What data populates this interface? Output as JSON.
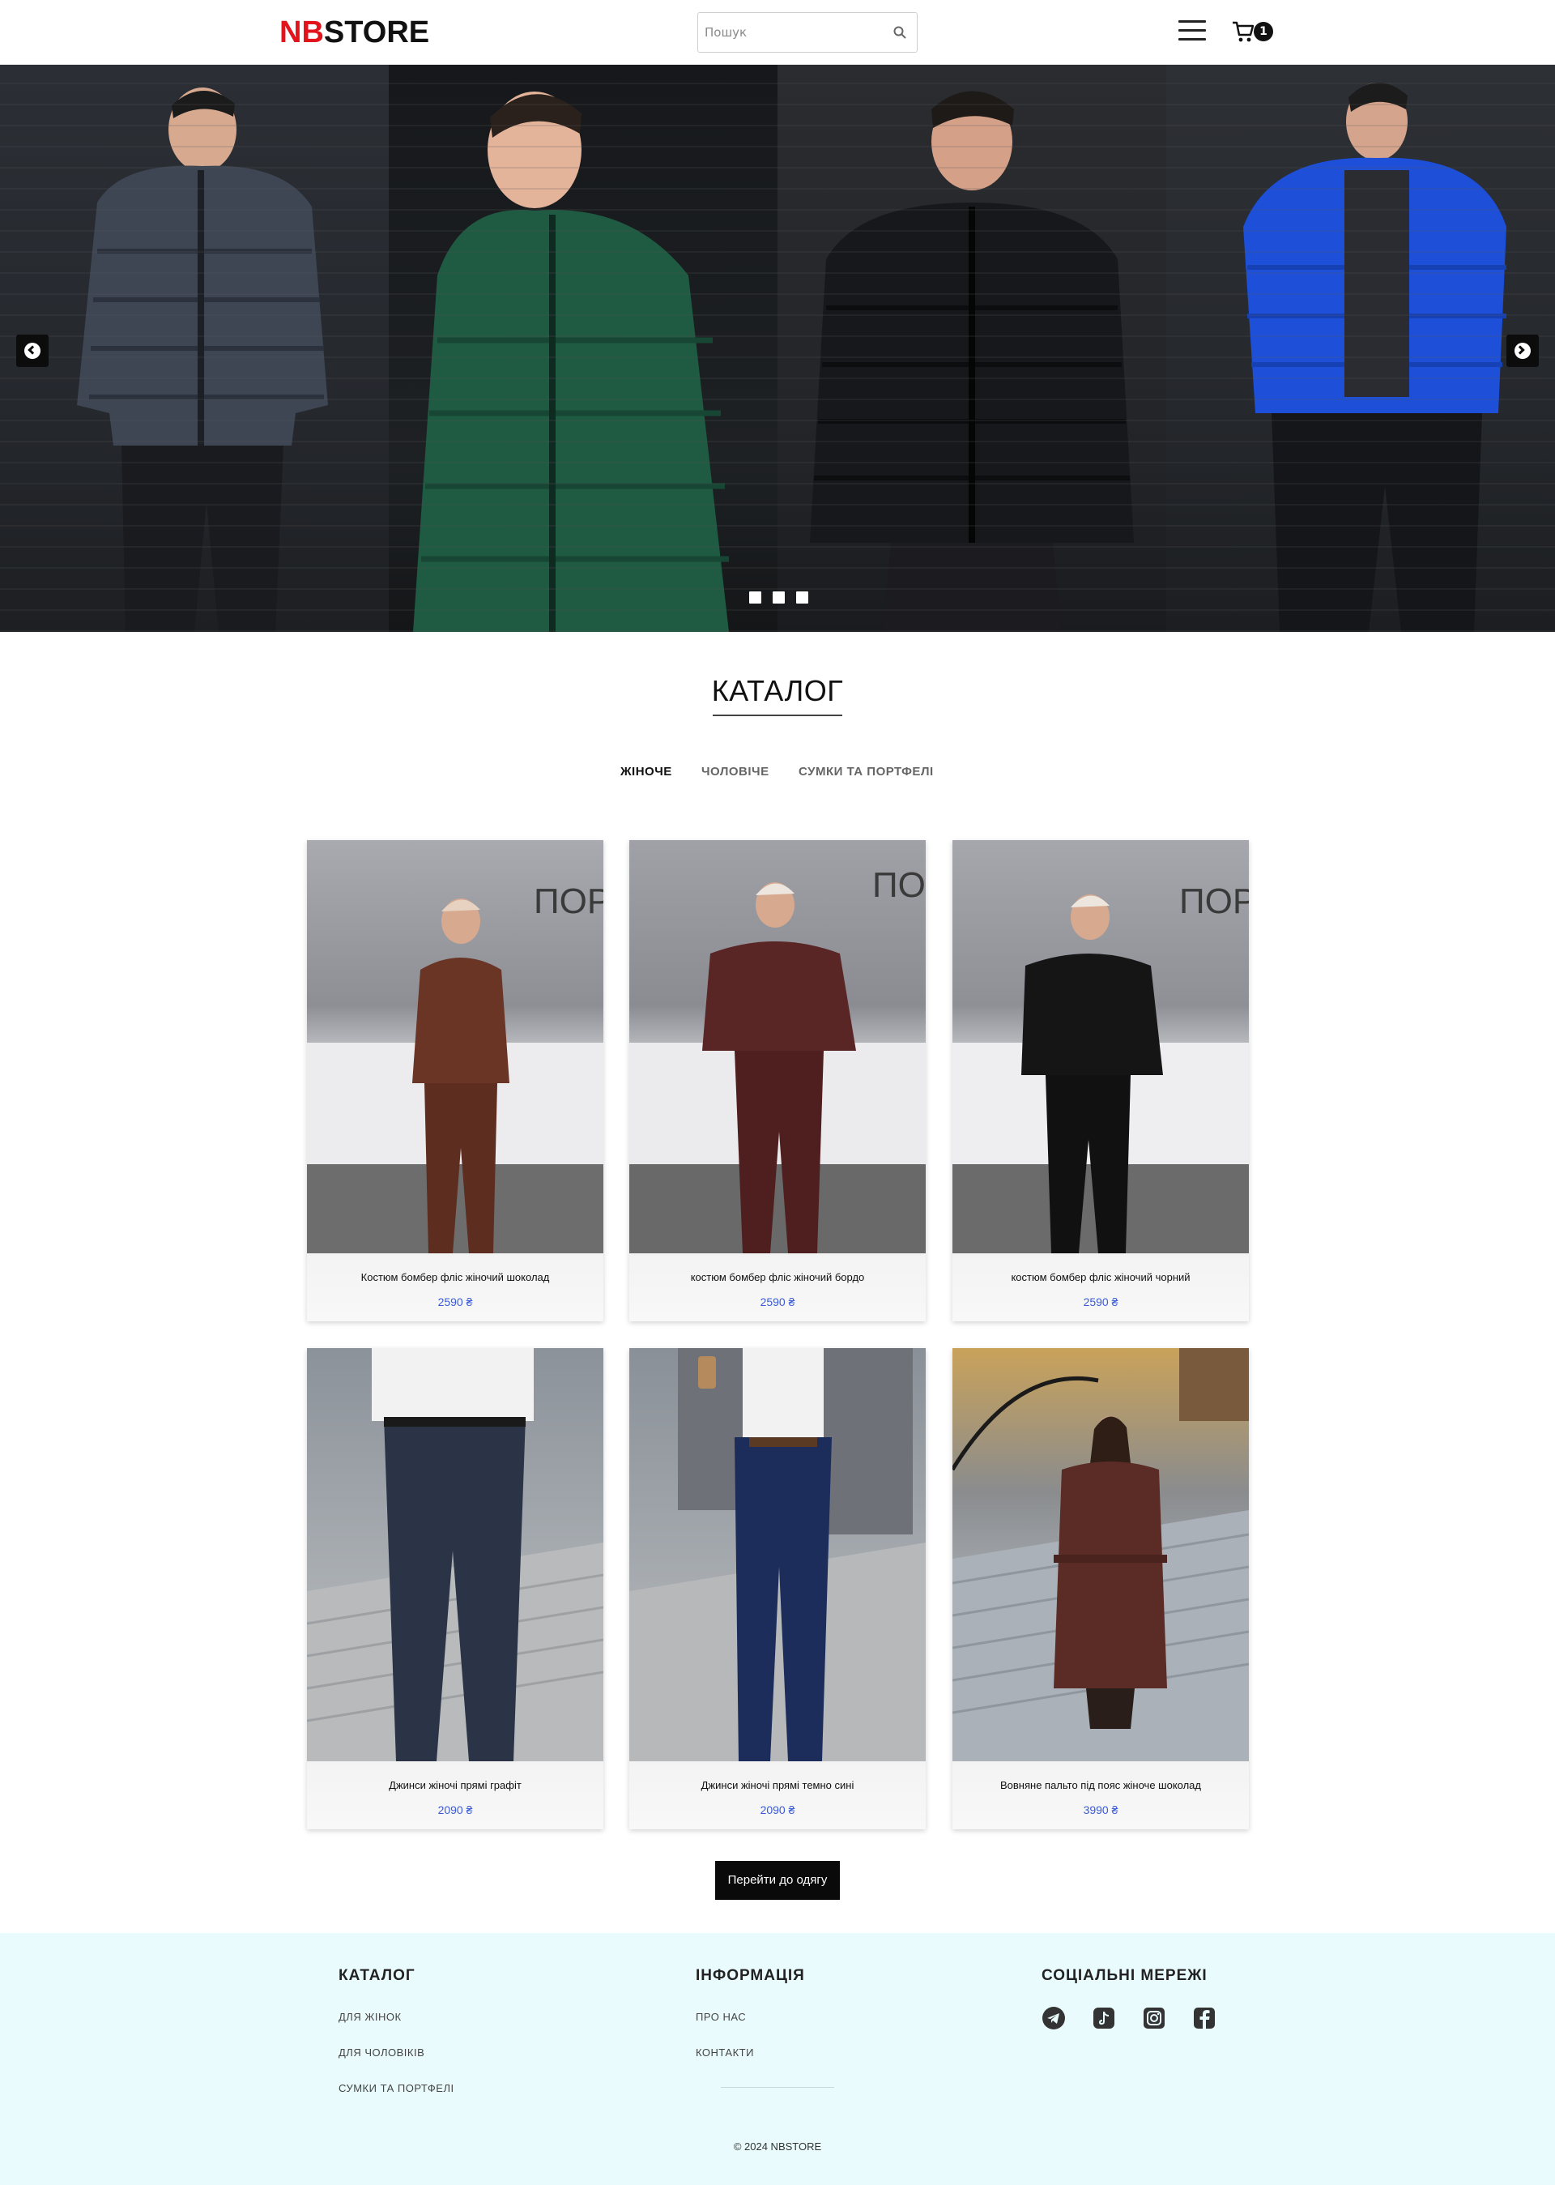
{
  "header": {
    "logo_nb": "NB",
    "logo_store": "STORE",
    "search_placeholder": "Пошук",
    "cart_count": "1"
  },
  "hero": {
    "slides": 3,
    "active_slide": 1,
    "panels": [
      {
        "jacket_color": "#3e4654"
      },
      {
        "jacket_color": "#1f5a42"
      },
      {
        "jacket_color": "#17181b"
      },
      {
        "jacket_color": "#1d4fd8"
      }
    ]
  },
  "catalog": {
    "title": "КАТАЛОГ",
    "tabs": [
      {
        "label": "ЖІНОЧЕ",
        "active": true
      },
      {
        "label": "ЧОЛОВІЧЕ",
        "active": false
      },
      {
        "label": "СУМКИ ТА ПОРТФЕЛІ",
        "active": false
      }
    ],
    "products": [
      {
        "name": "Костюм бомбер фліс жіночий шоколад",
        "price": "2590 ₴",
        "color": "#6a3525"
      },
      {
        "name": "костюм бомбер фліс жіночий бордо",
        "price": "2590 ₴",
        "color": "#5a2525"
      },
      {
        "name": "костюм бомбер фліс жіночий чорний",
        "price": "2590 ₴",
        "color": "#151515"
      },
      {
        "name": "Джинси жіночі прямі графіт",
        "price": "2090 ₴",
        "color": "#2b3447"
      },
      {
        "name": "Джинси жіночі прямі темно сині",
        "price": "2090 ₴",
        "color": "#1c2d5c"
      },
      {
        "name": "Вовняне пальто під пояс жіноче шоколад",
        "price": "3990 ₴",
        "color": "#5b2c26"
      }
    ],
    "cta_label": "Перейти до одягу"
  },
  "footer": {
    "catalog_title": "КАТАЛОГ",
    "catalog_links": [
      "ДЛЯ ЖІНОК",
      "ДЛЯ ЧОЛОВІКІВ",
      "СУМКИ ТА ПОРТФЕЛІ"
    ],
    "info_title": "ІНФОРМАЦІЯ",
    "info_links": [
      "ПРО НАС",
      "КОНТАКТИ"
    ],
    "social_title": "СОЦІАЛЬНІ МЕРЕЖІ",
    "social_icons": [
      "telegram-icon",
      "tiktok-icon",
      "instagram-icon",
      "facebook-icon"
    ],
    "copyright": "© 2024 NBSTORE"
  },
  "colors": {
    "brand_red": "#e3131b",
    "price_blue": "#3b5bd6",
    "footer_bg": "#e9fbfc"
  }
}
